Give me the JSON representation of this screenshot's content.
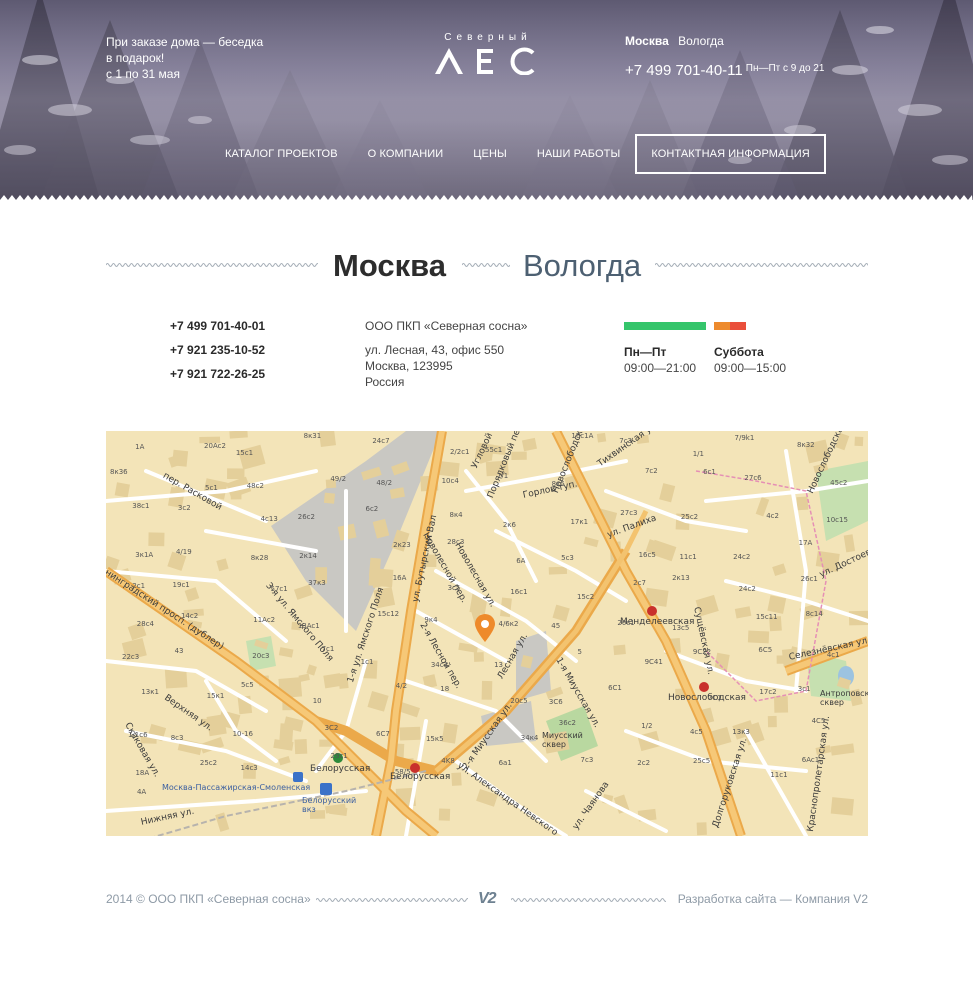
{
  "header": {
    "promo": [
      "При заказе дома — беседка",
      "в подарок!",
      "с 1 по 31 мая"
    ],
    "logo_sub": "Северный",
    "logo_main": "ЛЕС",
    "cities": {
      "active": "Москва",
      "other": "Вологда"
    },
    "phone": "+7 499 701-40-11",
    "hours": "Пн—Пт с 9 до 21"
  },
  "nav": [
    {
      "label": "КАТАЛОГ ПРОЕКТОВ",
      "active": false
    },
    {
      "label": "О КОМПАНИИ",
      "active": false
    },
    {
      "label": "ЦЕНЫ",
      "active": false
    },
    {
      "label": "НАШИ РАБОТЫ",
      "active": false
    },
    {
      "label": "КОНТАКТНАЯ ИНФОРМАЦИЯ",
      "active": true
    }
  ],
  "city_tabs": {
    "active": "Москва",
    "other": "Вологда"
  },
  "contacts": {
    "phones": [
      "+7 499 701-40-01",
      "+7 921 235-10-52",
      "+7 921 722-26-25"
    ],
    "company": "ООО ПКП «Северная сосна»",
    "address": [
      "ул. Лесная, 43, офис 550",
      "Москва, 123995",
      "Россия"
    ],
    "schedule": {
      "weekday_label": "Пн—Пт",
      "weekday_hours": "09:00—21:00",
      "saturday_label": "Суббота",
      "saturday_hours": "09:00—15:00"
    }
  },
  "colors": {
    "weekday": "#35c56b",
    "saturday_a": "#ed8a2d",
    "saturday_b": "#ea4f3b",
    "marker": "#ee8a2b",
    "metro": "#c9302c"
  },
  "map": {
    "streets": [
      "Новослободская ул.",
      "ул. Бутырский Вал",
      "Ленинградский просп. (дублер)",
      "Лесная ул.",
      "Долгоруковская ул.",
      "1-я Миусская ул.",
      "2-я Миусская ул.",
      "ул. Александра Невского",
      "ул. Палиха",
      "Селезнёвская ул.",
      "Краснопролетарская ул.",
      "Сущёвская ул.",
      "Новолесной пер.",
      "Новолесная ул.",
      "2-я Лесной пер.",
      "3-я ул. Ямского Поля",
      "1-я ул. Ямского Поля",
      "Верхняя ул.",
      "Горлов туп.",
      "Порядковый пер.",
      "Угловой пер.",
      "пер. Расковой",
      "Тихвинская ул.",
      "ул. Чаянова",
      "Нижняя ул.",
      "Скаковая ул.",
      "ул. Достоевского",
      "Новослободская ул."
    ],
    "metro": [
      "Менделеевская",
      "Новослободская",
      "Белорусская",
      "Белорусская"
    ],
    "places": [
      "Миусский сквер",
      "Антроповский сквер",
      "Москва-Пассажирская-Смоленская",
      "Белорусский вкз"
    ],
    "house_numbers": [
      "1A",
      "20Ac2",
      "15c1",
      "8к31",
      "24c7",
      "2/2c1",
      "55c1",
      "16c1A",
      "7c3",
      "1/1",
      "7/9k1",
      "8к32",
      "8к36",
      "5c1",
      "48c2",
      "49/2",
      "48/2",
      "10c4",
      "7/1",
      "8к5",
      "7c2",
      "6c1",
      "27c6",
      "45c2",
      "38c1",
      "3c2",
      "4c13",
      "26c2",
      "6c2",
      "8к4",
      "2к6",
      "17к1",
      "27c3",
      "25c2",
      "4c2",
      "10c15",
      "3к1A",
      "4/19",
      "8к28",
      "2к14",
      "2к23",
      "28c3",
      "6A",
      "5c3",
      "16c5",
      "11c1",
      "24c2",
      "17A",
      "2c1",
      "19c1",
      "57c1",
      "37к3",
      "16A",
      "3c5",
      "16c1",
      "15c2",
      "2c7",
      "2к13",
      "24c2",
      "26c1",
      "28c4",
      "14c2",
      "11Ac2",
      "13Ac1",
      "15c12",
      "9к4",
      "4/6к2",
      "45",
      "20c1",
      "13c5",
      "15c11",
      "8c14",
      "22c3",
      "43",
      "20c3",
      "7c1",
      "1c1",
      "34c3",
      "13",
      "5",
      "9C41",
      "9C22",
      "6C5",
      "4c1",
      "13к1",
      "15к1",
      "5c5",
      "10",
      "4/2",
      "18",
      "20c5",
      "3C6",
      "6C1",
      "7C1",
      "17c2",
      "3c1",
      "1/1c6",
      "8c3",
      "10-16",
      "3C2",
      "6C7",
      "15к5",
      "34к4",
      "36c2",
      "1/2",
      "4c5",
      "13к3",
      "4C5",
      "18A",
      "25c2",
      "14c3",
      "29c1",
      "58/5",
      "4K8",
      "6a1",
      "7c3",
      "2c2",
      "25c5",
      "11c1",
      "6Ac1",
      "4A"
    ]
  },
  "footer": {
    "copyright": "2014 © ООО ПКП «Северная сосна»",
    "dev_logo": "V2",
    "developer": "Разработка сайта — Компания V2"
  }
}
